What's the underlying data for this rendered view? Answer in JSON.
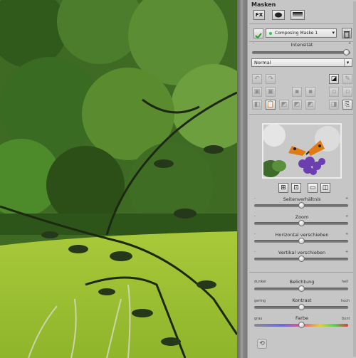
{
  "panel": {
    "title": "Masken",
    "fx_label": "FX",
    "mask_name": "Composing Maske 1",
    "intensity_label": "Intensität",
    "intensity_value": 0.96,
    "blend_mode": "Normal"
  },
  "sliders": [
    {
      "label": "Seitenverhältnis",
      "value": 0.5
    },
    {
      "label": "Zoom",
      "value": 0.5
    },
    {
      "label": "Horizontal verschieben",
      "value": 0.5
    },
    {
      "label": "Vertikal verschieben",
      "value": 0.5
    }
  ],
  "exposure": {
    "label": "Belichtung",
    "left": "dunkel",
    "right": "hell",
    "value": 0.5
  },
  "contrast": {
    "label": "Kontrast",
    "left": "gering",
    "right": "hoch",
    "value": 0.5
  },
  "color": {
    "label": "Farbe",
    "left": "grau",
    "right": "bunt",
    "value": 0.5
  },
  "minus": "-",
  "plus": "+",
  "icons": {
    "check": "checkmark-icon",
    "trash": "trash-icon",
    "mask_shape": "ellipse-mask-icon",
    "gradient": "gradient-mask-icon"
  },
  "colors": {
    "accent_check": "#2a9d2a",
    "status_dot": "#29c94a"
  }
}
